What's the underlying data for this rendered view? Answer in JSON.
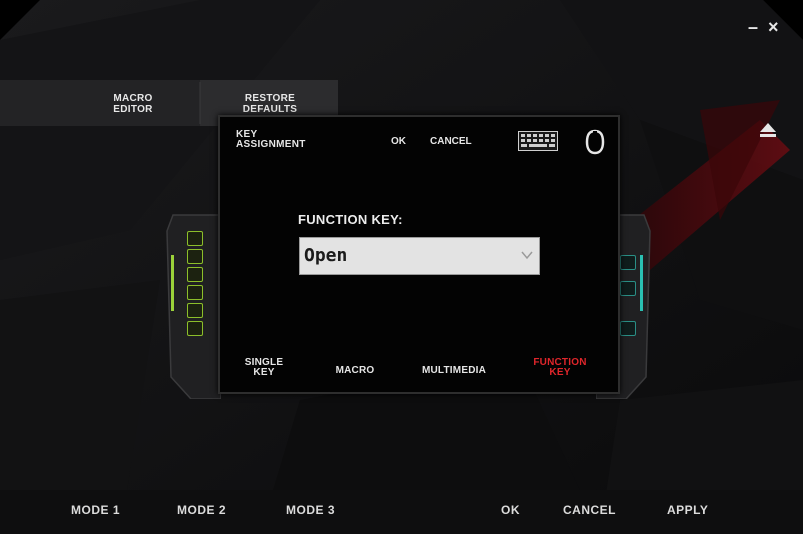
{
  "window": {
    "minimize_label": "–",
    "close_label": "×"
  },
  "toolbar": {
    "macro_editor_label": "MACRO\nEDITOR",
    "restore_defaults_label": "RESTORE\nDEFAULTS"
  },
  "icons": {
    "eject": "eject-icon",
    "keyboard": "keyboard-icon",
    "mouse": "mouse-icon",
    "dropdown": "chevron-down-icon"
  },
  "dialog": {
    "title": "KEY\nASSIGNMENT",
    "ok_label": "OK",
    "cancel_label": "CANCEL",
    "function_key_label": "FUNCTION KEY:",
    "function_key_value": "Open",
    "tabs": [
      {
        "label": "SINGLE\nKEY",
        "active": false
      },
      {
        "label": "MACRO",
        "active": false
      },
      {
        "label": "MULTIMEDIA",
        "active": false
      },
      {
        "label": "FUNCTION\nKEY",
        "active": true
      }
    ]
  },
  "bottom": {
    "mode1_label": "MODE 1",
    "mode2_label": "MODE 2",
    "mode3_label": "MODE 3",
    "ok_label": "OK",
    "cancel_label": "CANCEL",
    "apply_label": "APPLY"
  },
  "colors": {
    "accent_red": "#e0262b",
    "left_led": "#8cbf2a",
    "right_led": "#2a9d93",
    "background": "#0b0b0c"
  }
}
